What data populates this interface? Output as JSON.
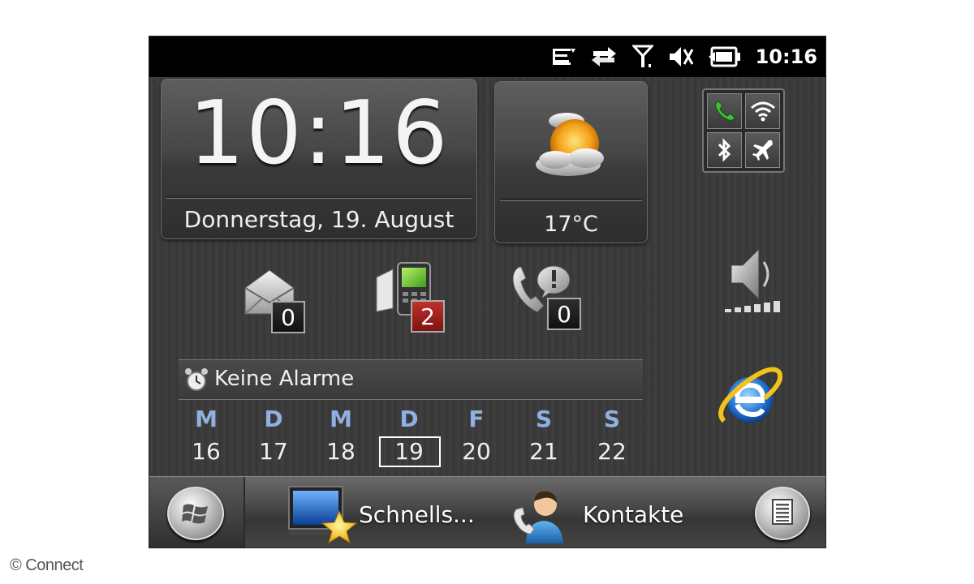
{
  "status_bar": {
    "time": "10:16",
    "icons": [
      "message-waiting-icon",
      "data-transfer-icon",
      "signal-antenna-icon",
      "speaker-muted-icon",
      "battery-icon"
    ]
  },
  "clock": {
    "time": "10:16",
    "date": "Donnerstag, 19. August"
  },
  "weather": {
    "condition_icon": "sun-behind-clouds-icon",
    "temperature": "17°C"
  },
  "connectivity": {
    "icons": [
      "phone-icon",
      "wifi-icon",
      "bluetooth-icon",
      "airplane-icon"
    ]
  },
  "notifications": {
    "email": {
      "icon": "envelope-icon",
      "count": "0"
    },
    "sms": {
      "icon": "phone-sms-icon",
      "count": "2"
    },
    "voicemail": {
      "icon": "voicemail-icon",
      "count": "0"
    }
  },
  "side_shortcuts": [
    "volume-icon",
    "internet-explorer-icon"
  ],
  "alarm": {
    "icon": "alarm-clock-icon",
    "text": "Keine Alarme"
  },
  "calendar": {
    "days": [
      {
        "weekday": "M",
        "date": "16"
      },
      {
        "weekday": "D",
        "date": "17"
      },
      {
        "weekday": "M",
        "date": "18"
      },
      {
        "weekday": "D",
        "date": "19"
      },
      {
        "weekday": "F",
        "date": "20"
      },
      {
        "weekday": "S",
        "date": "21"
      },
      {
        "weekday": "S",
        "date": "22"
      }
    ],
    "today_index": 3
  },
  "taskbar": {
    "start_icon": "windows-logo-icon",
    "quick_label": "Schnells...",
    "contacts_label": "Kontakte",
    "menu_icon": "menu-icon"
  },
  "watermark": "© Connect",
  "colors": {
    "weekday_blue": "#8fb0e0",
    "sms_badge_red": "#c0302a",
    "statusbar_black": "#000000"
  }
}
